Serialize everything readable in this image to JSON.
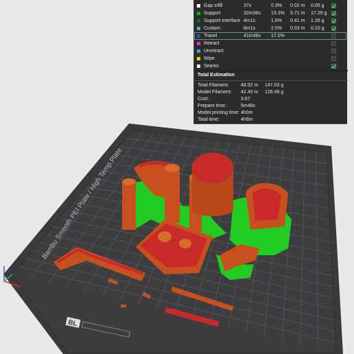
{
  "legend": {
    "rows": [
      {
        "name": "Gap infill",
        "time": "37s",
        "percent": "0.3%",
        "length": "0.02 m",
        "weight": "0.05 g",
        "color": "#ffffff",
        "checked": true
      },
      {
        "name": "Support",
        "time": "32m36s",
        "percent": "13.3%",
        "length": "5.71 m",
        "weight": "17.29 g",
        "color": "#00c000",
        "checked": true
      },
      {
        "name": "Support interface",
        "time": "4m1s",
        "percent": "1.6%",
        "length": "0.41 m",
        "weight": "1.26 g",
        "color": "#008000",
        "checked": true
      },
      {
        "name": "Custom",
        "time": "6m1s",
        "percent": "2.5%",
        "length": "0.03 m",
        "weight": "0.10 g",
        "color": "#5fa8a0",
        "checked": true
      },
      {
        "name": "Travel",
        "time": "41m46s",
        "percent": "17.0%",
        "length": "",
        "weight": "",
        "color": "#2a4dbf",
        "checked": false
      },
      {
        "name": "Retract",
        "time": "",
        "percent": "",
        "length": "",
        "weight": "",
        "color": "#cc33cc",
        "checked": false
      },
      {
        "name": "Unretract",
        "time": "",
        "percent": "",
        "length": "",
        "weight": "",
        "color": "#3fa0c8",
        "checked": false
      },
      {
        "name": "Wipe",
        "time": "",
        "percent": "",
        "length": "",
        "weight": "",
        "color": "#e6d000",
        "checked": false
      },
      {
        "name": "Seams",
        "time": "",
        "percent": "",
        "length": "",
        "weight": "",
        "color": "#e8e8e8",
        "checked": true
      }
    ]
  },
  "estimation": {
    "title": "Total Estimation",
    "rows": [
      {
        "label": "Total Filament:",
        "value": "48.52 m",
        "value2": "147.03 g"
      },
      {
        "label": "Model Filament:",
        "value": "42.40 m",
        "value2": "128.49 g"
      },
      {
        "label": "Cost:",
        "value": "3.67",
        "value2": ""
      },
      {
        "label": "Prepare time:",
        "value": "5m46s",
        "value2": ""
      },
      {
        "label": "Model printing time:",
        "value": "4h0m",
        "value2": ""
      },
      {
        "label": "Total time:",
        "value": "4h6m",
        "value2": ""
      }
    ]
  },
  "plate": {
    "label": "Bambu Smooth PEI Plate / High Temp Plate",
    "sticker": "BL",
    "colors": {
      "bed": "#3a3a3c",
      "grid": "#55555a",
      "model": "#c8501e",
      "top_surface": "#c82a2a",
      "support": "#22cc22"
    }
  }
}
